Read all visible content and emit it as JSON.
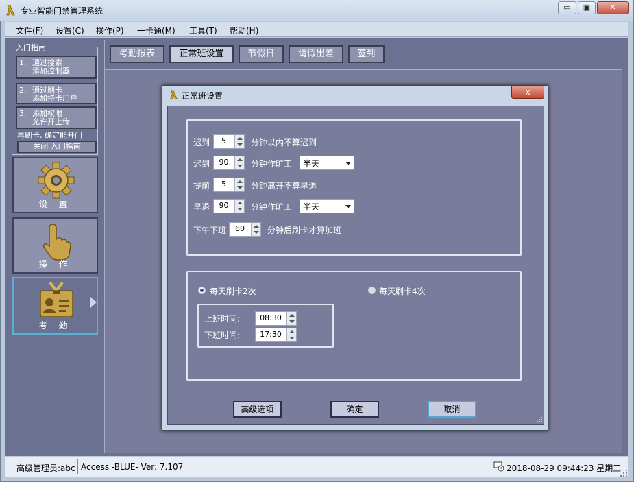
{
  "window": {
    "title": "专业智能门禁管理系统",
    "controls": [
      "▭",
      "▣",
      "✕"
    ]
  },
  "menu": [
    "文件(F)",
    "设置(C)",
    "操作(P)",
    "一卡通(M)",
    "工具(T)",
    "帮助(H)"
  ],
  "guide": {
    "title": "入门指南",
    "steps": [
      {
        "num": "1.",
        "line1": "通过搜索",
        "line2": "添加控制器"
      },
      {
        "num": "2.",
        "line1": "通过刷卡",
        "line2": "添加持卡用户"
      },
      {
        "num": "3.",
        "line1": "添加权限",
        "line2": "允许开上传"
      }
    ],
    "note": "再刷卡, 确定能开门",
    "close_label": "关闭 入门指南"
  },
  "nav": [
    {
      "label": "设 置",
      "icon": "gear-icon"
    },
    {
      "label": "操 作",
      "icon": "hand-pointer-icon"
    },
    {
      "label": "考 勤",
      "icon": "id-badge-icon"
    }
  ],
  "tabs": [
    "考勤报表",
    "正常班设置",
    "节假日",
    "请假出差",
    "签到"
  ],
  "dialog": {
    "title": "正常班设置",
    "close": "x",
    "rows": [
      {
        "label": "迟到",
        "value": "5",
        "suffix": "分钟以内不算迟到"
      },
      {
        "label": "迟到",
        "value": "90",
        "suffix": "分钟作旷工",
        "select": "半天"
      },
      {
        "label": "提前",
        "value": "5",
        "suffix": "分钟离开不算早退"
      },
      {
        "label": "早退",
        "value": "90",
        "suffix": "分钟作旷工",
        "select": "半天"
      },
      {
        "label": "下午下班",
        "value": "60",
        "suffix": "分钟后刷卡才算加班"
      }
    ],
    "radio_two": "每天刷卡2次",
    "radio_four": "每天刷卡4次",
    "on_time_label": "上班时间:",
    "on_time": "08:30",
    "off_time_label": "下班时间:",
    "off_time": "17:30",
    "btn_advanced": "高级选项",
    "btn_ok": "确定",
    "btn_cancel": "取消"
  },
  "status": {
    "user": "高级管理员:abc",
    "version": "Access -BLUE- Ver: 7.107",
    "datetime": "2018-08-29 09:44:23 星期三"
  },
  "colors": {
    "sidebar_bg": "#6b7291",
    "content_bg": "#7a7c9b",
    "dialog_frame": "#c8d6e7",
    "active_border": "#59b1d8"
  }
}
